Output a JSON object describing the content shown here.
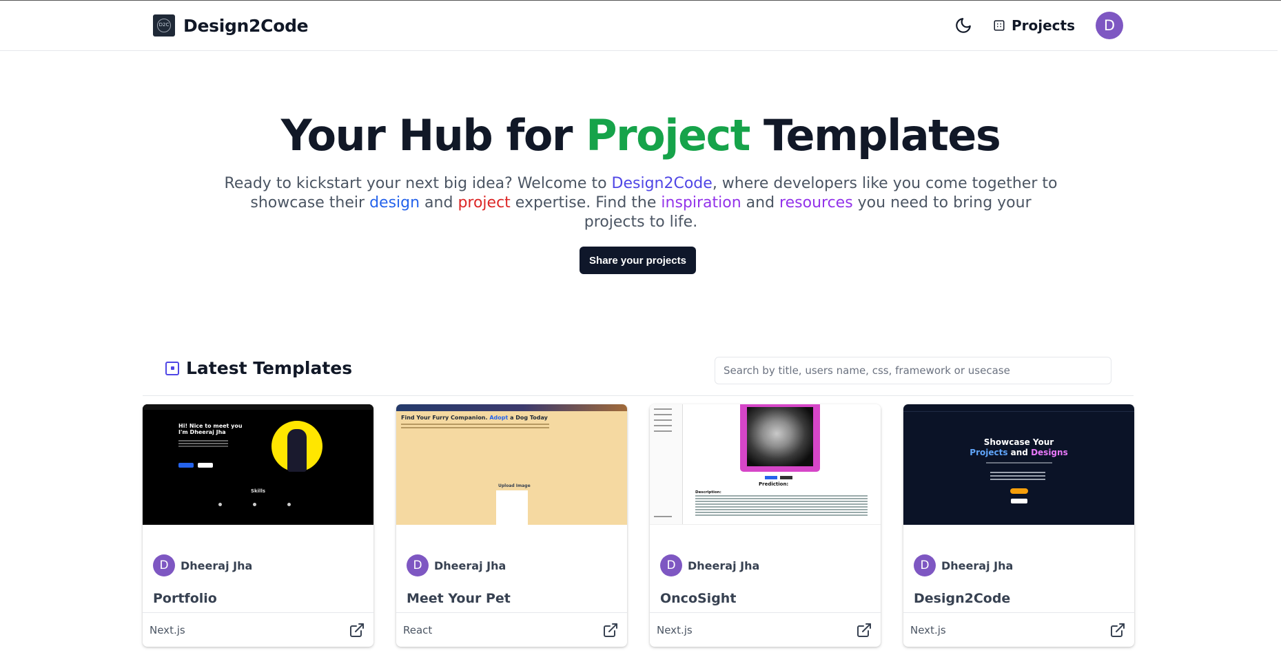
{
  "brand": {
    "name": "Design2Code",
    "logo_text": "D2C",
    "logo_icon": "d2c-logo-icon"
  },
  "nav": {
    "theme_icon": "moon-icon",
    "projects_label": "Projects",
    "projects_icon": "projects-icon",
    "avatar_initial": "D"
  },
  "hero": {
    "title_part1": "Your Hub for ",
    "title_highlight": "Project",
    "title_part2": " Templates",
    "sub": {
      "t1": "Ready to kickstart your next big idea? Welcome to ",
      "design2code": "Design2Code",
      "t2": ", where developers like you come together to showcase their ",
      "design": "design",
      "t3": " and ",
      "project": "project",
      "t4": " expertise. Find the ",
      "inspiration": "inspiration",
      "t5": " and ",
      "resources": "resources",
      "t6": " you need to bring your projects to life."
    },
    "cta_label": "Share your projects"
  },
  "templates": {
    "heading": "Latest Templates",
    "search_placeholder": "Search by title, users name, css, framework or usecase",
    "cards": [
      {
        "author": "Dheeraj Jha",
        "avatar_initial": "D",
        "title": "Portfolio",
        "tag": "Next.js",
        "thumb": {
          "greeting_line1": "Hi! Nice to meet you",
          "greeting_line2": "I'm Dheeraj Jha",
          "section": "Skills"
        }
      },
      {
        "author": "Dheeraj Jha",
        "avatar_initial": "D",
        "title": "Meet Your Pet",
        "tag": "React",
        "thumb": {
          "heading_part1": "Find Your Furry Companion. ",
          "heading_accent": "Adopt",
          "heading_part2": " a Dog Today",
          "upload": "Upload Image"
        }
      },
      {
        "author": "Dheeraj Jha",
        "avatar_initial": "D",
        "title": "OncoSight",
        "tag": "Next.js",
        "thumb": {
          "prediction": "Prediction:",
          "description": "Description:"
        }
      },
      {
        "author": "Dheeraj Jha",
        "avatar_initial": "D",
        "title": "Design2Code",
        "tag": "Next.js",
        "thumb": {
          "line1": "Showcase Your",
          "projects": "Projects",
          "and": " and ",
          "designs": "Designs"
        }
      }
    ]
  },
  "colors": {
    "accent_green": "#16a34a",
    "indigo": "#4f46e5",
    "blue": "#2563eb",
    "red": "#dc2626",
    "purple": "#9333ea",
    "avatar": "#7e57c2",
    "cta_bg": "#0f172a"
  }
}
